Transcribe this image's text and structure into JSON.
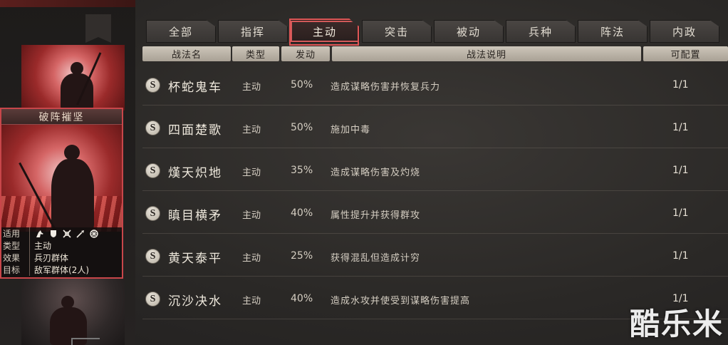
{
  "tabs": [
    {
      "label": "全部"
    },
    {
      "label": "指挥"
    },
    {
      "label": "主动",
      "active": true
    },
    {
      "label": "突击"
    },
    {
      "label": "被动"
    },
    {
      "label": "兵种"
    },
    {
      "label": "阵法"
    },
    {
      "label": "内政"
    }
  ],
  "table": {
    "headers": {
      "name": "战法名",
      "type": "类型",
      "rate": "发动",
      "desc": "战法说明",
      "conf": "可配置"
    },
    "rows": [
      {
        "badge": "S",
        "name": "杯蛇鬼车",
        "type": "主动",
        "rate": "50%",
        "desc": "造成谋略伤害并恢复兵力",
        "conf": "1/1"
      },
      {
        "badge": "S",
        "name": "四面楚歌",
        "type": "主动",
        "rate": "50%",
        "desc": "施加中毒",
        "conf": "1/1"
      },
      {
        "badge": "S",
        "name": "熯天炽地",
        "type": "主动",
        "rate": "35%",
        "desc": "造成谋略伤害及灼烧",
        "conf": "1/1"
      },
      {
        "badge": "S",
        "name": "瞋目横矛",
        "type": "主动",
        "rate": "40%",
        "desc": "属性提升并获得群攻",
        "conf": "1/1"
      },
      {
        "badge": "S",
        "name": "黄天泰平",
        "type": "主动",
        "rate": "25%",
        "desc": "获得混乱但造成计穷",
        "conf": "1/1"
      },
      {
        "badge": "S",
        "name": "沉沙决水",
        "type": "主动",
        "rate": "40%",
        "desc": "造成水攻并使受到谋略伤害提高",
        "conf": "1/1"
      }
    ]
  },
  "selected_card": {
    "title": "破阵摧坚",
    "stats": {
      "apply_label": "适用",
      "apply_icons": [
        "cavalry-icon",
        "shield-icon",
        "crossed-swords-icon",
        "spear-icon",
        "wheel-icon"
      ],
      "type_label": "类型",
      "type_value": "主动",
      "effect_label": "效果",
      "effect_value": "兵刃群体",
      "target_label": "目标",
      "target_value": "敌军群体(2人)"
    }
  },
  "watermark": "酷乐米",
  "colors": {
    "accent_red": "#d35a5a",
    "header_beige": "#cdc6ba",
    "background": "#2b2927"
  }
}
